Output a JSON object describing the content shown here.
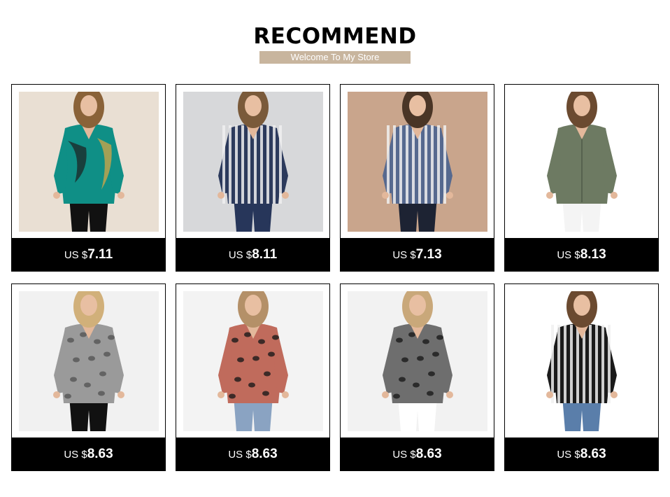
{
  "header": {
    "title": "RECOMMEND",
    "subtitle": "Welcome To My Store"
  },
  "products": [
    {
      "currency": "US $",
      "price": "7.11",
      "bg": "#e9dfd3",
      "shirt": "#0f8f86",
      "pattern": "tropical",
      "pants": "#111111",
      "hair": "#8a6238"
    },
    {
      "currency": "US $",
      "price": "8.11",
      "bg": "#d7d8da",
      "shirt": "#2c3a5c",
      "pattern": "stripes",
      "pants": "#27365a",
      "hair": "#7a5a3a"
    },
    {
      "currency": "US $",
      "price": "7.13",
      "bg": "#c9a58c",
      "shirt": "#56698f",
      "pattern": "stripes",
      "pants": "#1d2333",
      "hair": "#4a3526"
    },
    {
      "currency": "US $",
      "price": "8.13",
      "bg": "#ffffff",
      "shirt": "#6d7a62",
      "pattern": "solid",
      "pants": "#f4f4f4",
      "hair": "#6b4a30"
    },
    {
      "currency": "US $",
      "price": "8.63",
      "bg": "#f1f1f1",
      "shirt": "#9a9a9a",
      "pattern": "snake",
      "pants": "#111111",
      "hair": "#d1b07a"
    },
    {
      "currency": "US $",
      "price": "8.63",
      "bg": "#f3f3f3",
      "shirt": "#c06b5c",
      "pattern": "leopard",
      "pants": "#8aa3c2",
      "hair": "#b49068"
    },
    {
      "currency": "US $",
      "price": "8.63",
      "bg": "#f2f2f2",
      "shirt": "#6e6e6e",
      "pattern": "leopard",
      "pants": "#ffffff",
      "hair": "#c9a87a"
    },
    {
      "currency": "US $",
      "price": "8.63",
      "bg": "#ffffff",
      "shirt": "#1a1a1a",
      "pattern": "stripes",
      "pants": "#5a7eaa",
      "hair": "#6b4a30"
    }
  ]
}
